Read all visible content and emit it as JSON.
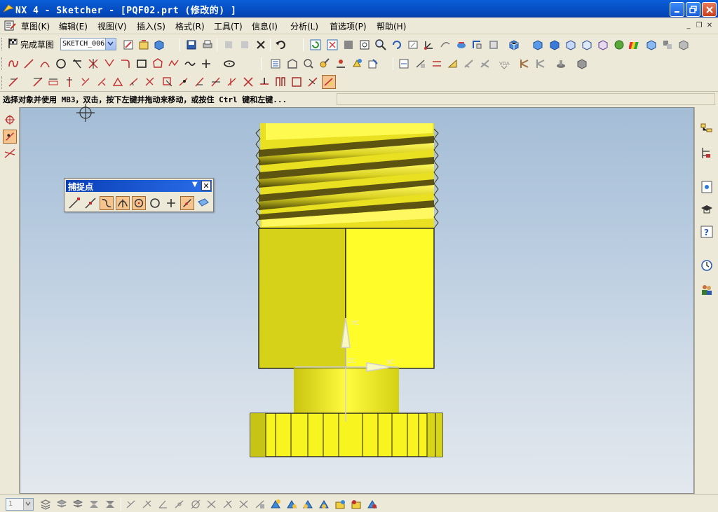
{
  "window": {
    "title": "NX 4 - Sketcher - [PQF02.prt  (修改的) ]",
    "icon": "nx-logo-icon"
  },
  "menubar": {
    "items": [
      "草图(K)",
      "编辑(E)",
      "视图(V)",
      "插入(S)",
      "格式(R)",
      "工具(T)",
      "信息(I)",
      "分析(L)",
      "首选项(P)",
      "帮助(H)"
    ]
  },
  "sketch_toolbar": {
    "finish_label": "完成草图",
    "sketch_name": "SKETCH_006"
  },
  "cue_line": {
    "text": "选择对象并使用 MB3，双击，按下左键并拖动来移动，或按住 Ctrl 键和左键..."
  },
  "snap_dialog": {
    "title": "捕捉点",
    "buttons": [
      "end-point",
      "mid-point",
      "control-point",
      "intersection",
      "arc-center",
      "quadrant",
      "existing-point",
      "point-on-curve",
      "point-on-surface"
    ],
    "active": [
      "control-point",
      "intersection",
      "arc-center",
      "point-on-curve"
    ]
  },
  "bottom_toolbar": {
    "layer_value": "1"
  },
  "colors": {
    "part_yellow": "#f4f020",
    "part_shadow": "#bcb810",
    "thread_dark": "#5c5410",
    "background_top": "#a4bdd6",
    "background_bottom": "#e3e8ee"
  }
}
